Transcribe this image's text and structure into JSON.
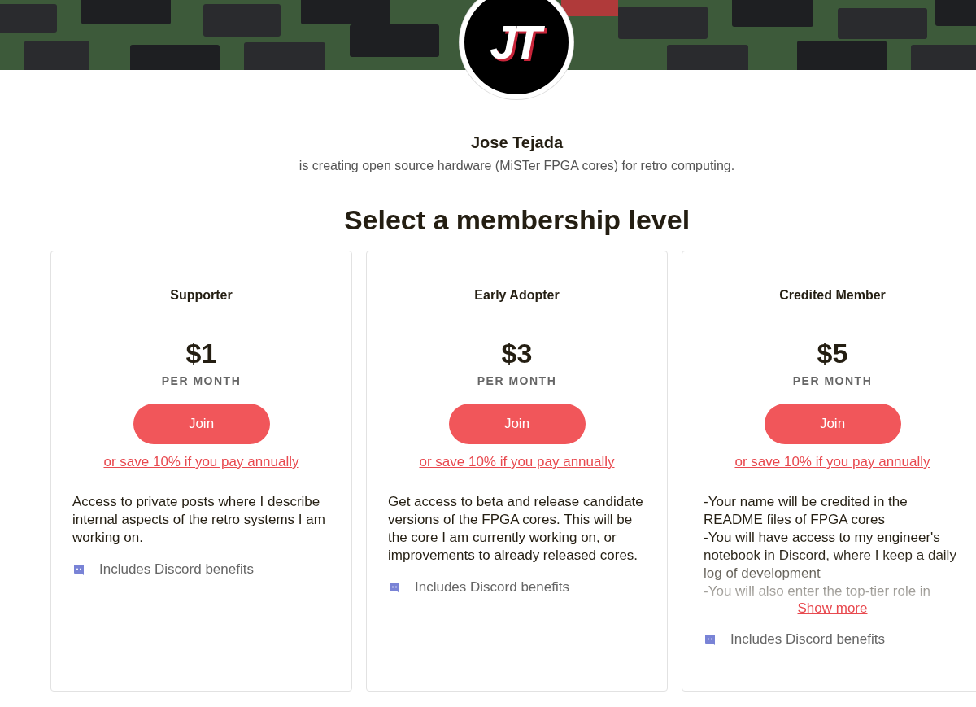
{
  "avatar": {
    "logo_text": "JT"
  },
  "creator": {
    "name": "Jose Tejada",
    "tagline": "is creating open source hardware (MiSTer FPGA cores) for retro computing."
  },
  "heading": "Select a membership level",
  "tiers": [
    {
      "name": "Supporter",
      "price": "$1",
      "period": "PER MONTH",
      "button": "Join",
      "annual_link": "or save 10% if you pay annually",
      "description": [
        "Access to private posts where I describe internal aspects of the retro systems I am working on."
      ],
      "collapsed": false,
      "benefit": "Includes Discord benefits"
    },
    {
      "name": "Early Adopter",
      "price": "$3",
      "period": "PER MONTH",
      "button": "Join",
      "annual_link": "or save 10% if you pay annually",
      "description": [
        "Get access to beta and release candidate versions of the FPGA cores. This will be the core I am currently working on, or improvements to already released cores."
      ],
      "collapsed": false,
      "benefit": "Includes Discord benefits"
    },
    {
      "name": "Credited Member",
      "price": "$5",
      "period": "PER MONTH",
      "button": "Join",
      "annual_link": "or save 10% if you pay annually",
      "description": [
        "-Your name will be credited in the README files of FPGA cores",
        "-You will have access to my engineer's notebook in Discord, where I keep a daily log of development",
        "-You will also enter the top-tier role in"
      ],
      "collapsed": true,
      "show_more": "Show more",
      "benefit": "Includes Discord benefits"
    }
  ]
}
